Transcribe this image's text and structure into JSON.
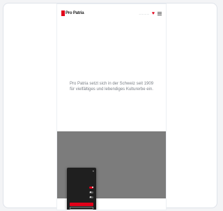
{
  "colors": {
    "accent": "#e2001a",
    "overlay": "#7c7c7c",
    "cookie_bg": "#1f1f1f"
  },
  "header": {
    "logo_text": "Pro Patria",
    "nav_text": "— — — —",
    "heart_icon": "heart-icon",
    "menu_icon": "menu-icon"
  },
  "hero": {
    "intro": "Pro Patria setzt sich in der Schweiz seit 1909 für vielfältiges und lebendiges Kulturerbe ein."
  },
  "section": {
    "headline": "",
    "body": ""
  },
  "cta": {
    "link": "",
    "note": ""
  },
  "cookie": {
    "title": "",
    "body": "",
    "options": [
      {
        "label": "",
        "on": true
      },
      {
        "label": "",
        "on": false
      },
      {
        "label": "",
        "on": false
      }
    ],
    "accept_label": "",
    "save_label": ""
  }
}
